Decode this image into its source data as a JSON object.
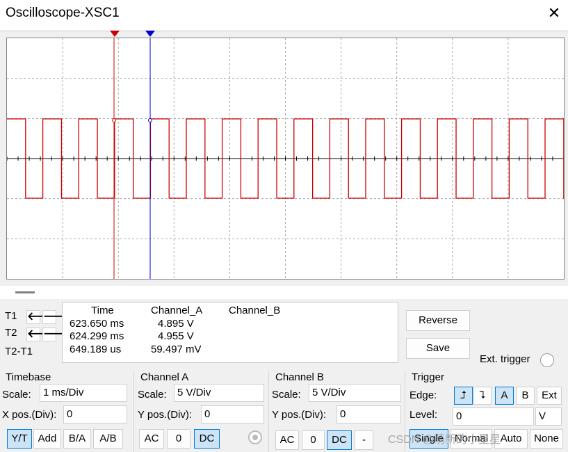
{
  "window": {
    "title": "Oscilloscope-XSC1",
    "close_glyph": "✕"
  },
  "cursors": {
    "t1_marker": "1",
    "t2_marker": "2"
  },
  "readout": {
    "headers": [
      "Time",
      "Channel_A",
      "Channel_B"
    ],
    "rows": [
      {
        "label": "T1",
        "time": "623.650 ms",
        "a": "4.895 V",
        "b": ""
      },
      {
        "label": "T2",
        "time": "624.299 ms",
        "a": "4.955 V",
        "b": ""
      },
      {
        "label": "T2-T1",
        "time": "649.189 us",
        "a": "59.497 mV",
        "b": ""
      }
    ],
    "arrow_left": "🡐",
    "arrow_right": "🡒"
  },
  "buttons": {
    "reverse": "Reverse",
    "save": "Save",
    "ext_trigger": "Ext. trigger"
  },
  "timebase": {
    "title": "Timebase",
    "scale_label": "Scale:",
    "scale_value": "1 ms/Div",
    "xpos_label": "X pos.(Div):",
    "xpos_value": "0",
    "modes": [
      "Y/T",
      "Add",
      "B/A",
      "A/B"
    ]
  },
  "channel_a": {
    "title": "Channel A",
    "scale_label": "Scale:",
    "scale_value": "5  V/Div",
    "ypos_label": "Y pos.(Div):",
    "ypos_value": "0",
    "coupling": [
      "AC",
      "0",
      "DC"
    ]
  },
  "channel_b": {
    "title": "Channel B",
    "scale_label": "Scale:",
    "scale_value": "5  V/Div",
    "ypos_label": "Y pos.(Div):",
    "ypos_value": "0",
    "coupling": [
      "AC",
      "0",
      "DC",
      "-"
    ]
  },
  "trigger": {
    "title": "Trigger",
    "edge_label": "Edge:",
    "edge_rising": "⮥",
    "edge_falling": "⮧",
    "sources": [
      "A",
      "B",
      "Ext"
    ],
    "level_label": "Level:",
    "level_value": "0",
    "level_unit": "V",
    "modes": [
      "Single",
      "Normal",
      "Auto",
      "None"
    ]
  },
  "watermark": "CSDN @萌新的小星星",
  "colors": {
    "trace": "#cc0000",
    "cursor1": "#cc0000",
    "cursor2": "#0000cc",
    "selected": "#cce4f7",
    "selected_border": "#0078d4"
  }
}
